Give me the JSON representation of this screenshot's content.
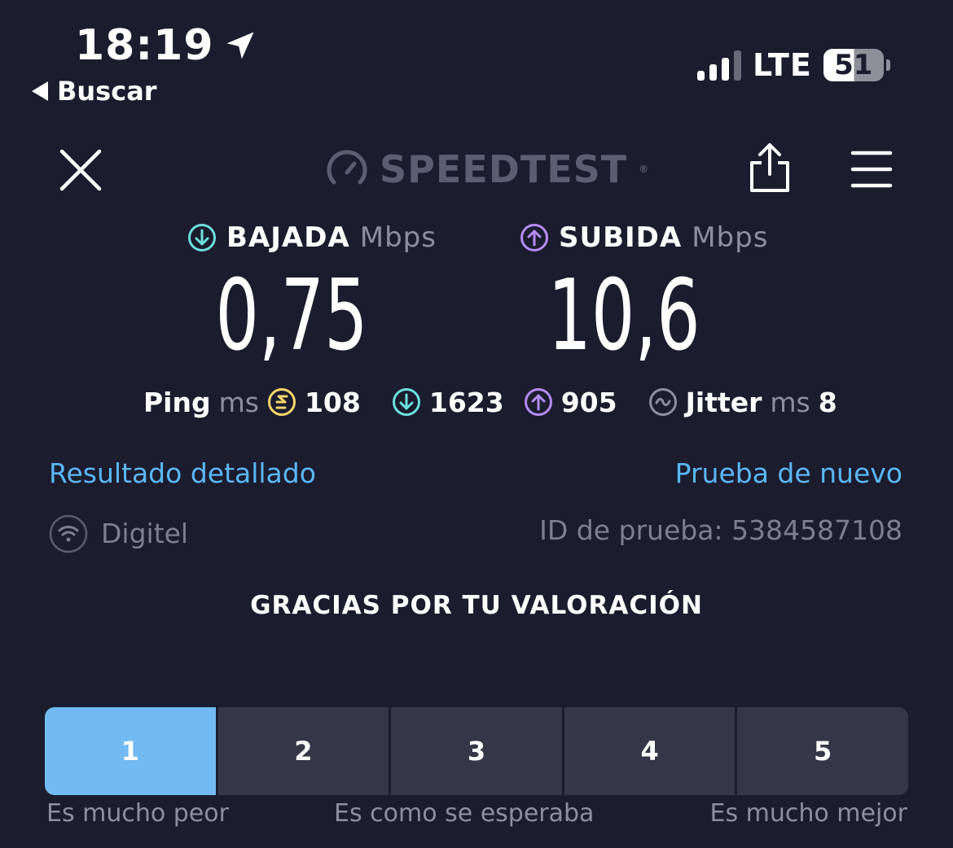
{
  "status_bar": {
    "time": "18:19",
    "back_label": "Buscar",
    "network": "LTE",
    "battery": "51",
    "battery_level": 0.51
  },
  "header": {
    "logo_text": "SPEEDTEST",
    "logo_mark": "®"
  },
  "download": {
    "label": "BAJADA",
    "unit": "Mbps",
    "value": "0,75"
  },
  "upload": {
    "label": "SUBIDA",
    "unit": "Mbps",
    "value": "10,6"
  },
  "stats": {
    "ping_label": "Ping",
    "ping_unit": "ms",
    "ping_value": "108",
    "download_latency": "1623",
    "upload_latency": "905",
    "jitter_label": "Jitter",
    "jitter_unit": "ms",
    "jitter_value": "8"
  },
  "links": {
    "detailed": "Resultado detallado",
    "retry": "Prueba de nuevo"
  },
  "info": {
    "provider": "Digitel",
    "test_id": "ID de prueba: 5384587108"
  },
  "rating": {
    "thanks": "GRACIAS POR TU VALORACIÓN",
    "options": [
      "1",
      "2",
      "3",
      "4",
      "5"
    ],
    "selected": "1",
    "scale_left": "Es mucho peor",
    "scale_mid": "Es como se esperaba",
    "scale_right": "Es mucho mejor"
  },
  "colors": {
    "background": "#1b1c2e",
    "download_accent": "#6de0dc",
    "upload_accent": "#b48cf2",
    "ping_accent": "#f5d66a",
    "link": "#5bb7f5",
    "rating_active": "#72baf3"
  }
}
